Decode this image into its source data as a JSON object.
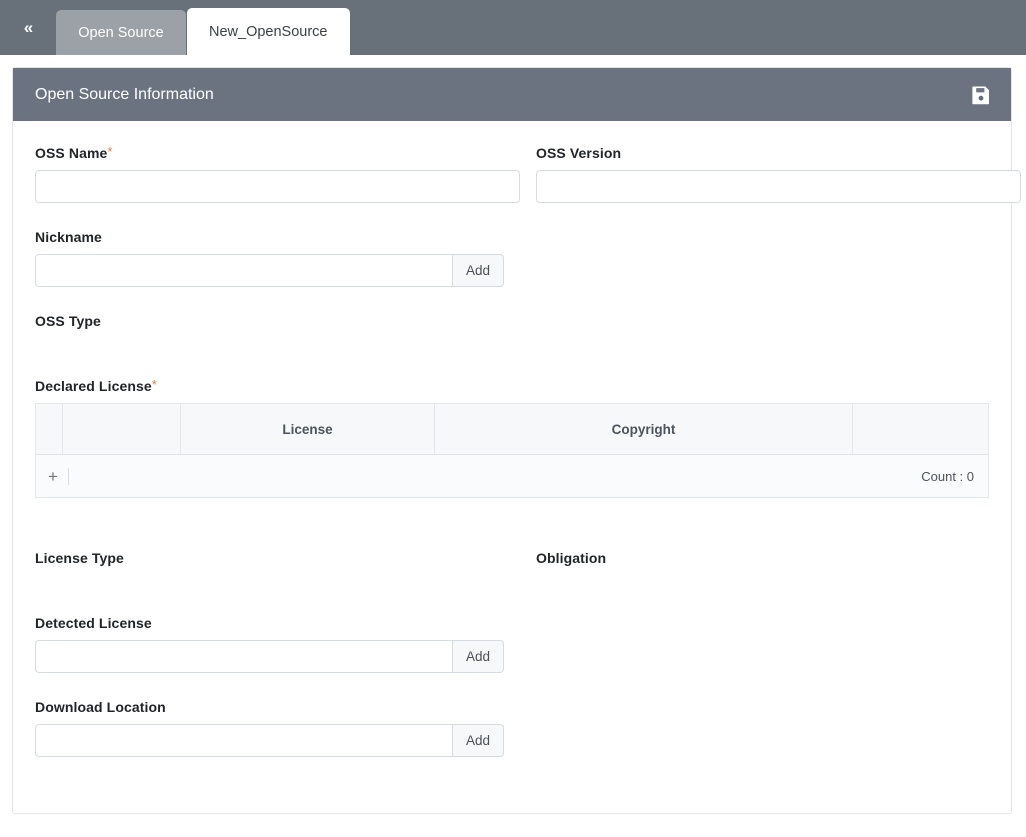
{
  "tabbar": {
    "collapse_label": "«",
    "collapse_icon": "chevron-double-left-icon",
    "tabs": [
      {
        "label": "Open Source",
        "active": false
      },
      {
        "label": "New_OpenSource",
        "active": true
      }
    ]
  },
  "panel": {
    "title": "Open Source Information",
    "save_icon": "save-floppy-icon",
    "header_color": "#6b7381"
  },
  "form": {
    "oss_name": {
      "label": "OSS Name",
      "required_marker": "*",
      "value": "",
      "placeholder": ""
    },
    "oss_version": {
      "label": "OSS Version",
      "value": "",
      "placeholder": ""
    },
    "nickname": {
      "label": "Nickname",
      "value": "",
      "placeholder": "",
      "add_label": "Add"
    },
    "oss_type": {
      "label": "OSS Type"
    },
    "declared_license": {
      "label": "Declared License",
      "required_marker": "*"
    },
    "license_type": {
      "label": "License Type"
    },
    "obligation": {
      "label": "Obligation"
    },
    "detected_license": {
      "label": "Detected License",
      "value": "",
      "placeholder": "",
      "add_label": "Add"
    },
    "download_location": {
      "label": "Download Location",
      "value": "",
      "placeholder": "",
      "add_label": "Add"
    }
  },
  "license_grid": {
    "columns": [
      "",
      "",
      "License",
      "Copyright",
      ""
    ],
    "rows": [],
    "add_row_icon": "plus-icon",
    "count_label": "Count : 0"
  },
  "colors": {
    "tabbar_bg": "#68707a",
    "tab_inactive_bg": "#9ba1a7",
    "panel_header_bg": "#6b7381",
    "required_asterisk": "#f07c3e",
    "input_border": "#d5dbe0"
  }
}
